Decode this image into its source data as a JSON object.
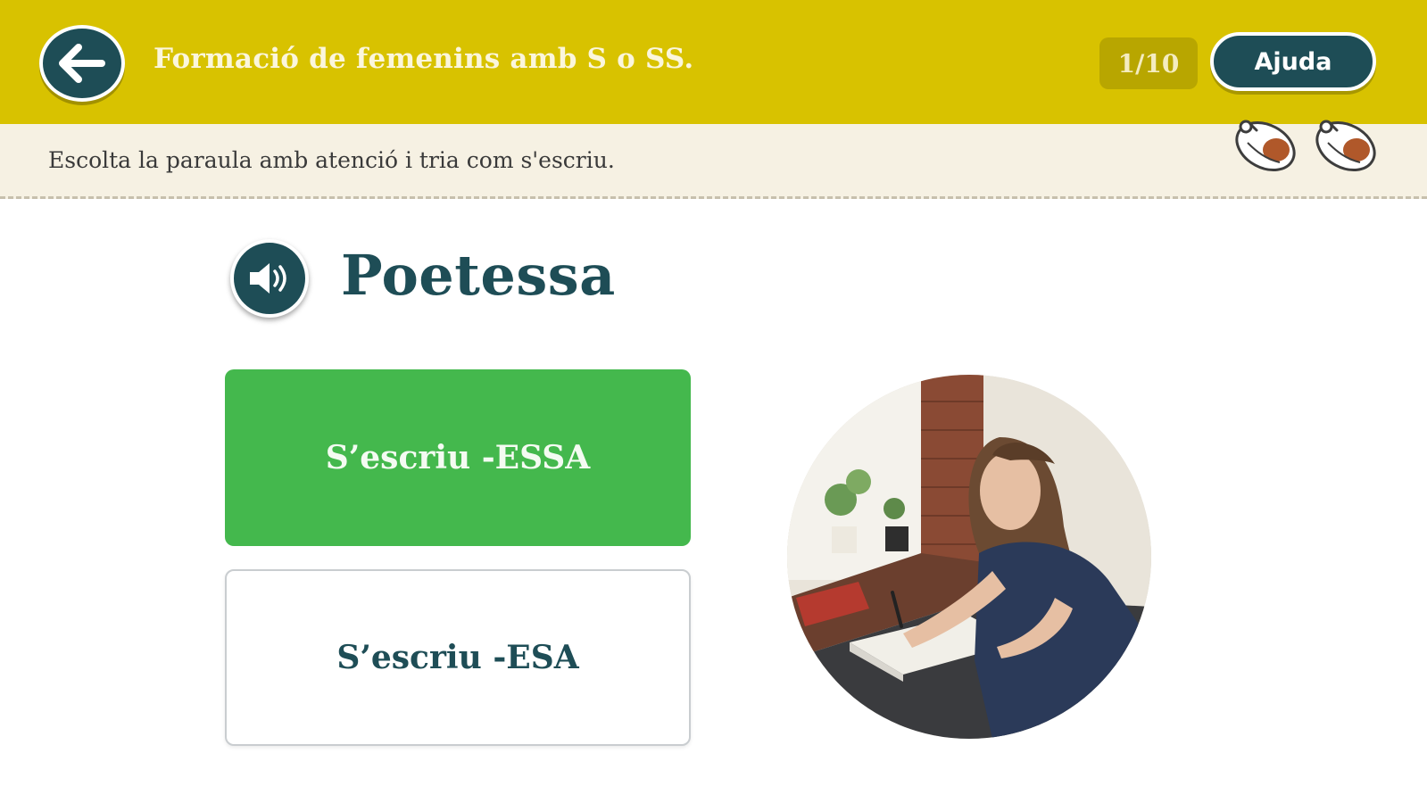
{
  "header": {
    "title": "Formació de femenins amb S o SS.",
    "progress": "1/10",
    "help_label": "Ajuda",
    "background_color": "#d8c200",
    "accent_color": "#1e4d56",
    "back_icon": "arrow-left-icon"
  },
  "instruction": {
    "text": "Escolta la paraula amb atenció i tria com s'escriu.",
    "lives": [
      "life-icon",
      "life-icon"
    ]
  },
  "main": {
    "audio_icon": "speaker-icon",
    "word": "Poetessa",
    "options": [
      {
        "label": "S’escriu -ESSA",
        "state": "selected-correct",
        "color": "#44b84d"
      },
      {
        "label": "S’escriu -ESA",
        "state": "unselected",
        "color": "#ffffff"
      }
    ],
    "image": "woman-writing-photo"
  }
}
